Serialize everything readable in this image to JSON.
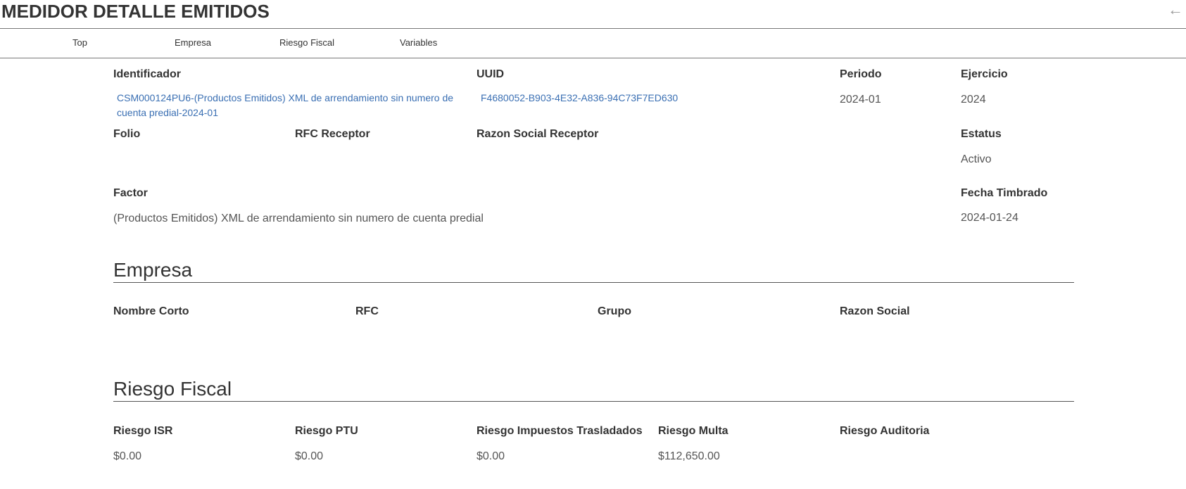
{
  "header": {
    "title": "MEDIDOR DETALLE EMITIDOS",
    "back_icon": "arrow-left-icon"
  },
  "nav": {
    "tabs": [
      {
        "label": "Top"
      },
      {
        "label": "Empresa"
      },
      {
        "label": "Riesgo Fiscal"
      },
      {
        "label": "Variables"
      }
    ]
  },
  "top": {
    "identificador": {
      "label": "Identificador",
      "line1": "CSM000124PU6-(Productos Emitidos) XML de arrendamiento sin numero de",
      "line2": "cuenta predial-2024-01"
    },
    "uuid": {
      "label": "UUID",
      "value": "F4680052-B903-4E32-A836-94C73F7ED630"
    },
    "periodo": {
      "label": "Periodo",
      "value": "2024-01"
    },
    "ejercicio": {
      "label": "Ejercicio",
      "value": "2024"
    },
    "folio": {
      "label": "Folio",
      "value": ""
    },
    "rfc_receptor": {
      "label": "RFC Receptor",
      "value": ""
    },
    "razon_social_receptor": {
      "label": "Razon Social Receptor",
      "value": ""
    },
    "estatus": {
      "label": "Estatus",
      "value": "Activo"
    },
    "factor": {
      "label": "Factor",
      "value": "(Productos Emitidos) XML de arrendamiento sin numero de cuenta predial"
    },
    "fecha_timbrado": {
      "label": "Fecha Timbrado",
      "value": "2024-01-24"
    }
  },
  "empresa": {
    "title": "Empresa",
    "nombre_corto": {
      "label": "Nombre Corto",
      "value": ""
    },
    "rfc": {
      "label": "RFC",
      "value": ""
    },
    "grupo": {
      "label": "Grupo",
      "value": ""
    },
    "razon_social": {
      "label": "Razon Social",
      "value": ""
    }
  },
  "riesgo_fiscal": {
    "title": "Riesgo Fiscal",
    "isr": {
      "label": "Riesgo ISR",
      "value": "$0.00"
    },
    "ptu": {
      "label": "Riesgo PTU",
      "value": "$0.00"
    },
    "impuestos_trasladados": {
      "label": "Riesgo Impuestos Trasladados",
      "value": "$0.00"
    },
    "multa": {
      "label": "Riesgo Multa",
      "value": "$112,650.00"
    },
    "auditoria": {
      "label": "Riesgo Auditoria",
      "value": ""
    }
  }
}
